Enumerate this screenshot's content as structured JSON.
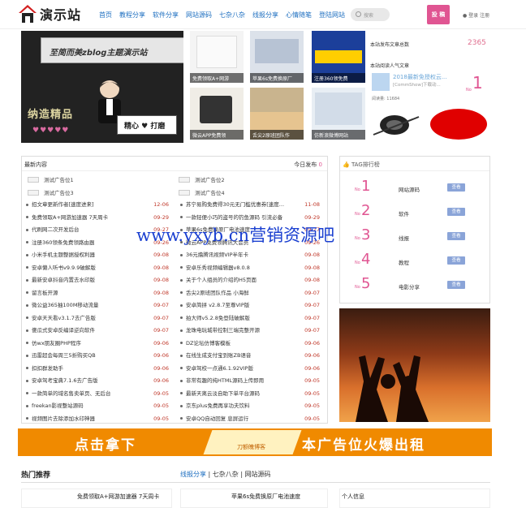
{
  "site": {
    "title": "演示站"
  },
  "nav": [
    "首页",
    "教程分享",
    "软件分享",
    "网站源码",
    "七杂八杂",
    "线报分享",
    "心情随笔",
    "登陆网站"
  ],
  "search": {
    "placeholder": "搜索"
  },
  "post_button": "投 稿",
  "login": "登录  注册",
  "hero": {
    "banner": "至简而美zblog主题演示站",
    "left_text": "纳造精品",
    "hearts": "♥♥♥♥♥",
    "sign": "精心 ♥ 打磨"
  },
  "thumbs": [
    {
      "caption": "免费领取A+网游"
    },
    {
      "caption": "苹果6s免费换原厂"
    },
    {
      "caption": "注册360领免费"
    },
    {
      "caption": "微云APP免费领"
    },
    {
      "caption": "舌尖2原班团队作"
    },
    {
      "caption": "仿新浪微博网站"
    }
  ],
  "stats": {
    "site_posts_label": "本站发布文章总数",
    "site_posts": "2365",
    "popular_label": "本站阅读人气文章",
    "card_title": "2018最新免授权云...",
    "card_sub": "[CommShow]下载动...",
    "card_views": "阅读量: 11684",
    "card_no": "No",
    "card_rank": "1"
  },
  "latest": {
    "title": "最新内容",
    "today_label": "今日发布",
    "today_count": "0",
    "ads": [
      "测试广告位1",
      "测试广告位2",
      "测试广告位3",
      "测试广告位4"
    ],
    "left": [
      {
        "t": "招文章更新作者[速度进来]",
        "d": "12-06"
      },
      {
        "t": "免费领取A+网游加速器 7天周卡",
        "d": "09-29"
      },
      {
        "t": "代刷网二次开发后台",
        "d": "09-27"
      },
      {
        "t": "注册360领条免费领路由器",
        "d": "09-26"
      },
      {
        "t": "小米手机主题整据授权利器",
        "d": "09-08"
      },
      {
        "t": "安卓懒人听书v9.9.9破解版",
        "d": "09-08"
      },
      {
        "t": "最新安卓抖音内置去水印版",
        "d": "09-08"
      },
      {
        "t": "留言板开源",
        "d": "09-08"
      },
      {
        "t": "微公益365抽100M移动流量",
        "d": "09-07"
      },
      {
        "t": "安卓天天看v3.1.7去广告版",
        "d": "09-07"
      },
      {
        "t": "傻瓜式安卓反编译逆向软件",
        "d": "09-07"
      },
      {
        "t": "仿wx朋友圈PHP程序",
        "d": "09-06"
      },
      {
        "t": "迅雷超会每周三5折购买QB",
        "d": "09-06"
      },
      {
        "t": "扣扣群发助手",
        "d": "09-06"
      },
      {
        "t": "安卓驾考宝典7.1.6去广告版",
        "d": "09-06"
      },
      {
        "t": "一款简单的域名售卖单页、无后台",
        "d": "09-05"
      },
      {
        "t": "freekan影视整站源码",
        "d": "09-05"
      },
      {
        "t": "视频图片去除添加水印神器",
        "d": "09-05"
      }
    ],
    "right": [
      {
        "t": "苏宁易购免费得30元无门槛优惠券[速度...",
        "d": "11-08"
      },
      {
        "t": "一款轻便小巧的盗号的钓鱼源码 引流必备",
        "d": "09-29"
      },
      {
        "t": "苹果6s免费换原厂电池速度",
        "d": "09-27"
      },
      {
        "t": "微云APP免费领腾讯大会员",
        "d": "09-26"
      },
      {
        "t": "36元撸腾讯视频VIP半年卡",
        "d": "09-08"
      },
      {
        "t": "安卓乐秀视频编辑器v8.0.8",
        "d": "09-08"
      },
      {
        "t": "关于个人组员的介绍的H5页面",
        "d": "09-08"
      },
      {
        "t": "舌尖2原班团队作品 小海鲜",
        "d": "09-07"
      },
      {
        "t": "安卓简拼 v2.8.7至尊VIP版",
        "d": "09-07"
      },
      {
        "t": "拍大师v5.2.8免登陆破解版",
        "d": "09-07"
      },
      {
        "t": "龙珠电玩城带控制三端完整开源",
        "d": "09-07"
      },
      {
        "t": "DZ论坛仿博客模板",
        "d": "09-06"
      },
      {
        "t": "在线生成支付宝到账ZB语音",
        "d": "09-06"
      },
      {
        "t": "安卓驾校一点通6.1.92VIP版",
        "d": "09-06"
      },
      {
        "t": "非常有趣的纯HTML源码上传即用",
        "d": "09-05"
      },
      {
        "t": "最新天离云淡自助下单平台源码",
        "d": "09-05"
      },
      {
        "t": "京东plus免费再享功夫饮料",
        "d": "09-05"
      },
      {
        "t": "安卓QQ自动回复 息屏运行",
        "d": "09-05"
      }
    ]
  },
  "tags": {
    "title": "TAG排行榜",
    "badge": "查看",
    "no": "No",
    "items": [
      {
        "rank": "1",
        "name": "网站源码"
      },
      {
        "rank": "2",
        "name": "软件"
      },
      {
        "rank": "3",
        "name": "线报"
      },
      {
        "rank": "4",
        "name": "教程"
      },
      {
        "rank": "5",
        "name": "电影分享"
      }
    ]
  },
  "watermark": "www.yxyb.cn营销资源吧",
  "ad": {
    "left": "点击拿下",
    "right": "本广告位火爆出租",
    "mid": "刀额魄博客"
  },
  "bottom": {
    "hot": "热门推荐",
    "crumb": [
      "线报分享",
      "七杂八杂",
      "网站源码"
    ],
    "sep": " | ",
    "b1": "免费领取A+网游加速器 7天周卡",
    "b2": "苹果6s免费换原厂电池速度",
    "b3": "个人信息"
  },
  "colors": {
    "accent": "#e05592",
    "link": "#1e6fc0",
    "date": "#c0392b"
  }
}
